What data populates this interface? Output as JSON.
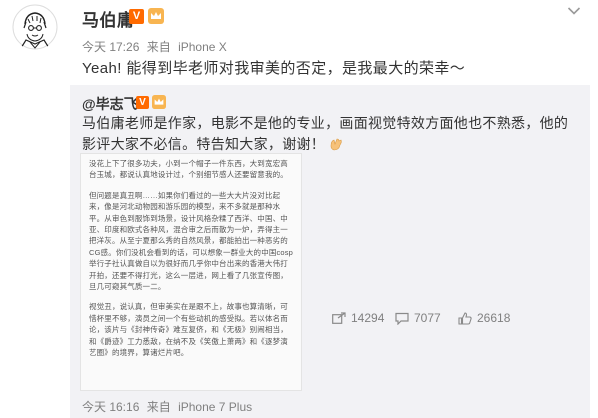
{
  "post": {
    "username": "马伯庸",
    "vip_mark": "V",
    "meta": {
      "time": "今天 17:26",
      "source_prefix": "来自",
      "device": "iPhone X"
    },
    "text": "Yeah! 能得到毕老师对我审美的否定，是我最大的荣幸～"
  },
  "repost": {
    "author": "@毕志飞",
    "vip_mark": "V",
    "text": "马伯庸老师是作家，电影不是他的专业，画面视觉特效方面他也不熟悉，他的影评大家不必信。特告知大家，谢谢！",
    "screenshot_paragraphs": [
      "没花上下了很多功夫，小到一个帽子一件东西，大到宽宏高台玉城，都说认真地设计过，个别细节感人还要留意我的。",
      "但问题是真丑啊……如果你们看过的一些大大片没对比起来，像是河北动物园和游乐园的模型，来不多就是那种水平。从审色到服饰到场景，设计风格杂糅了西洋、中国、中亚、印度和欧式各种风，混合审之后而散为一炉，弄得主一把洋灰。从至宁夏那么秀的自然风景，都能拍出一种恶劣的CG感。你们没机会看到的话，可以想象一群业大的中国cosp举行子社认真做自以为很好而几乎你中台出来的香港大伟打开拍，还要不得打光，这么一层进，网上看了几张宣传图，旦几可窥其气质一二。",
      "视觉丑，说认真，但审美实在是跟不上，故事也算清晰，可惜杯里不够，演员之间一个有些动机的感受拟。若以体名而论，该片与《封神传奇》难互复侪，和《无极》别闹相当，和《爵迹》工力悉敌，在纳不及《笑傲上萧两》和《逐梦演艺圈》的境界，算诸烂片吧。"
    ],
    "meta": {
      "time": "今天 16:16",
      "source_prefix": "来自",
      "device": "iPhone 7 Plus"
    },
    "stats": {
      "shares": "14294",
      "comments": "7077",
      "likes": "26618"
    }
  },
  "colors": {
    "accent": "#eb7350",
    "vip": "#ff6a00",
    "meta_gray": "#808080",
    "repost_bg": "#f2f2f5"
  }
}
